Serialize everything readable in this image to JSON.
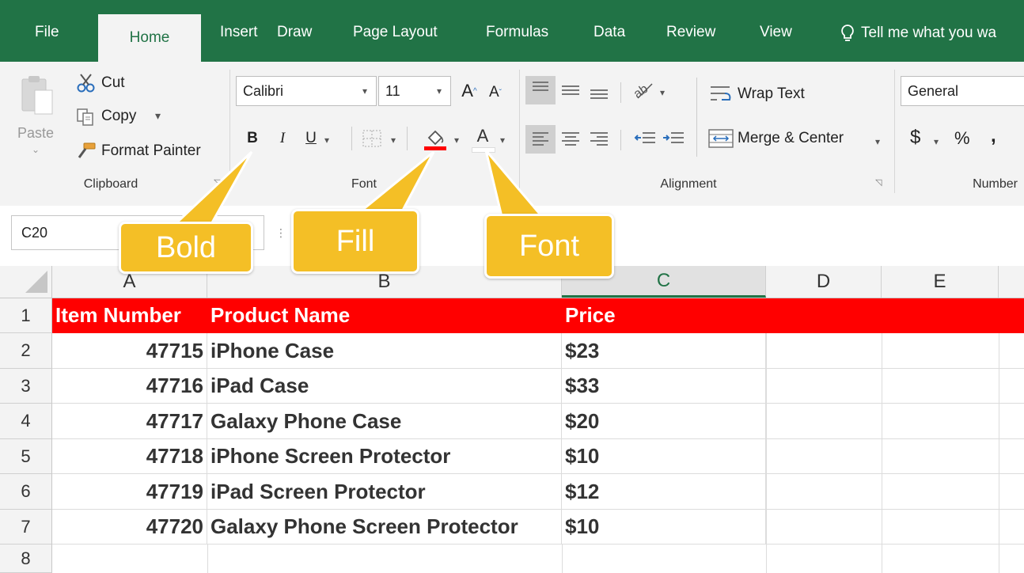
{
  "ribbon_tabs": [
    "File",
    "Home",
    "Insert",
    "Draw",
    "Page Layout",
    "Formulas",
    "Data",
    "Review",
    "View"
  ],
  "tell_me": "Tell me what you wa",
  "clipboard": {
    "paste": "Paste",
    "cut": "Cut",
    "copy": "Copy",
    "format_painter": "Format Painter",
    "label": "Clipboard"
  },
  "font": {
    "name": "Calibri",
    "size": "11",
    "bold": "B",
    "italic": "I",
    "underline": "U",
    "grow": "A",
    "shrink": "A",
    "font_color": "A",
    "label": "Font"
  },
  "alignment": {
    "wrap_text": "Wrap Text",
    "merge_center": "Merge & Center",
    "label": "Alignment"
  },
  "number": {
    "format": "General",
    "currency": "$",
    "percent": "%",
    "comma": ",",
    "label": "Number"
  },
  "name_box": "C20",
  "callouts": {
    "bold": "Bold",
    "fill": "Fill",
    "font": "Font"
  },
  "columns": [
    "A",
    "B",
    "C",
    "D",
    "E"
  ],
  "rows": [
    "1",
    "2",
    "3",
    "4",
    "5",
    "6",
    "7",
    "8"
  ],
  "sheet": {
    "header": [
      "Item Number",
      "Product Name",
      "Price"
    ],
    "data": [
      [
        "47715",
        "iPhone Case",
        "$23"
      ],
      [
        "47716",
        "iPad Case",
        "$33"
      ],
      [
        "47717",
        "Galaxy Phone Case",
        "$20"
      ],
      [
        "47718",
        "iPhone Screen Protector",
        "$10"
      ],
      [
        "47719",
        "iPad Screen Protector",
        "$12"
      ],
      [
        "47720",
        "Galaxy Phone Screen Protector",
        "$10"
      ]
    ]
  },
  "colors": {
    "excel_green": "#217346",
    "header_fill": "#ff0000",
    "callout": "#f4bf26"
  }
}
